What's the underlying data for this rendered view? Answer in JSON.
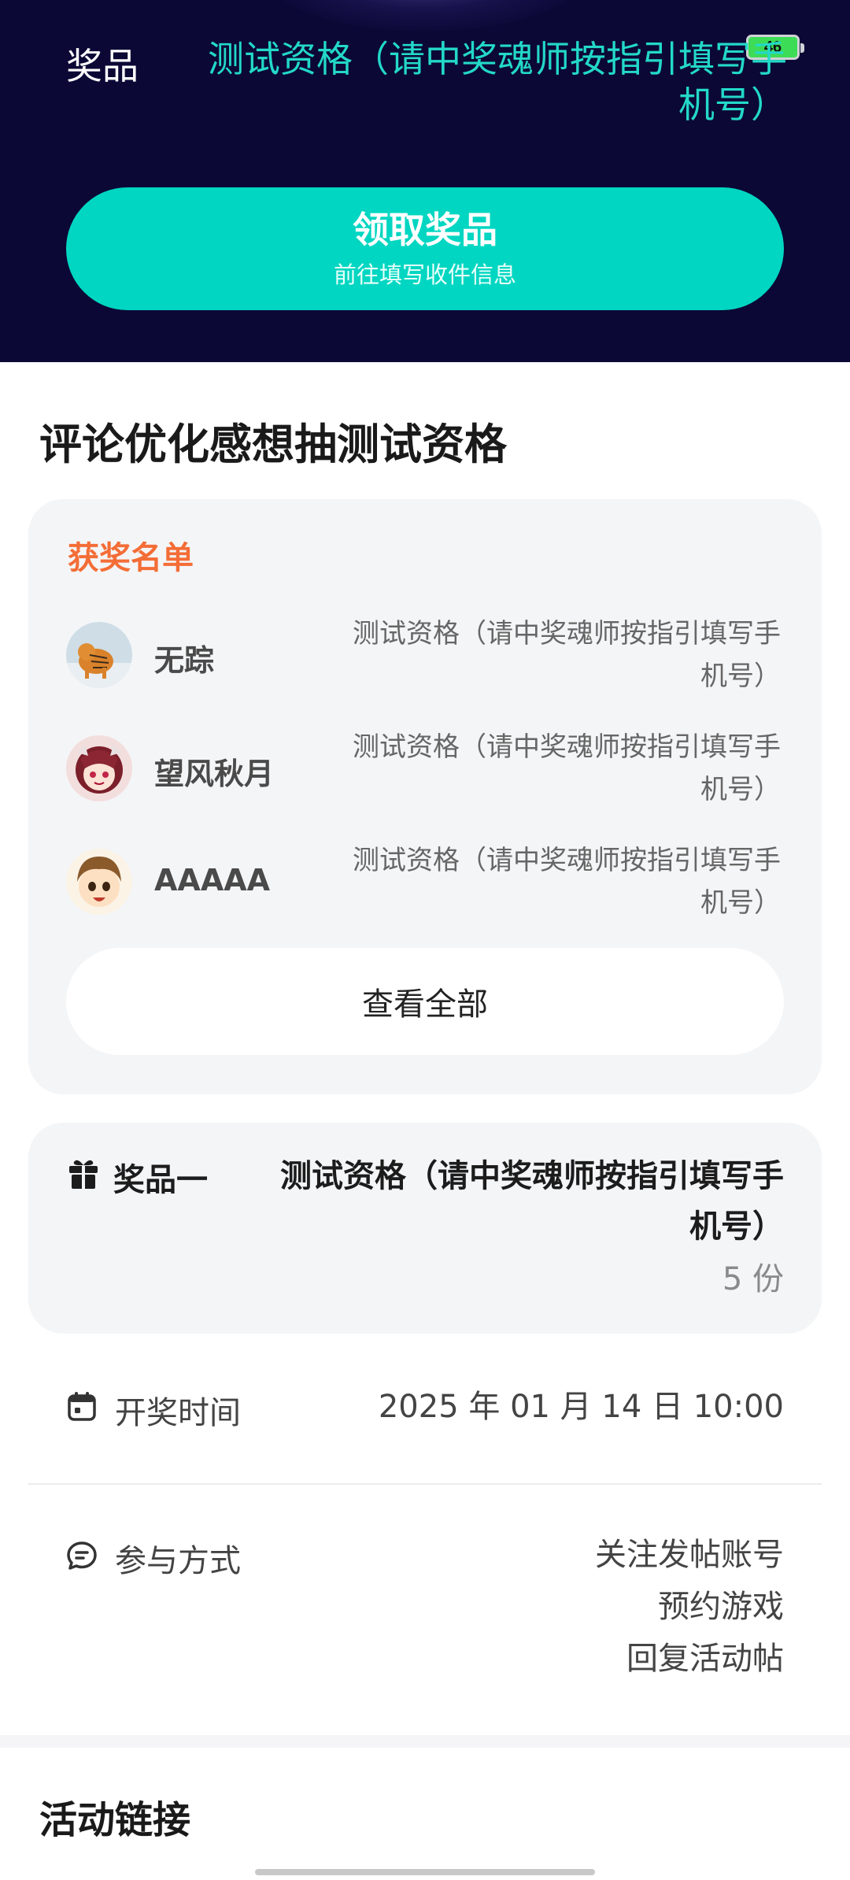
{
  "status_bar": {
    "battery_level": "46"
  },
  "hero": {
    "prize_label": "奖品",
    "prize_name": "测试资格（请中奖魂师按指引填写手机号）",
    "claim_button": {
      "title": "领取奖品",
      "subtitle": "前往填写收件信息"
    }
  },
  "lottery": {
    "title": "评论优化感想抽测试资格"
  },
  "winners": {
    "heading": "获奖名单",
    "items": [
      {
        "name": "无踪",
        "prize": "测试资格（请中奖魂师按指引填写手机号）"
      },
      {
        "name": "望风秋月",
        "prize": "测试资格（请中奖魂师按指引填写手机号）"
      },
      {
        "name": "AAAAA",
        "prize": "测试资格（请中奖魂师按指引填写手机号）"
      }
    ],
    "view_all_label": "查看全部"
  },
  "prize_card": {
    "label": "奖品一",
    "name": "测试资格（请中奖魂师按指引填写手机号）",
    "quantity": "5 份"
  },
  "draw_time": {
    "label": "开奖时间",
    "value": "2025 年 01 月 14 日 10:00"
  },
  "participation": {
    "label": "参与方式",
    "methods": [
      "关注发帖账号",
      "预约游戏",
      "回复活动帖"
    ]
  },
  "links_section": {
    "title": "活动链接"
  },
  "colors": {
    "hero_bg": "#0b0836",
    "accent_teal": "#00d6c1",
    "winners_heading": "#f46d36",
    "card_bg": "#f4f5f7"
  }
}
